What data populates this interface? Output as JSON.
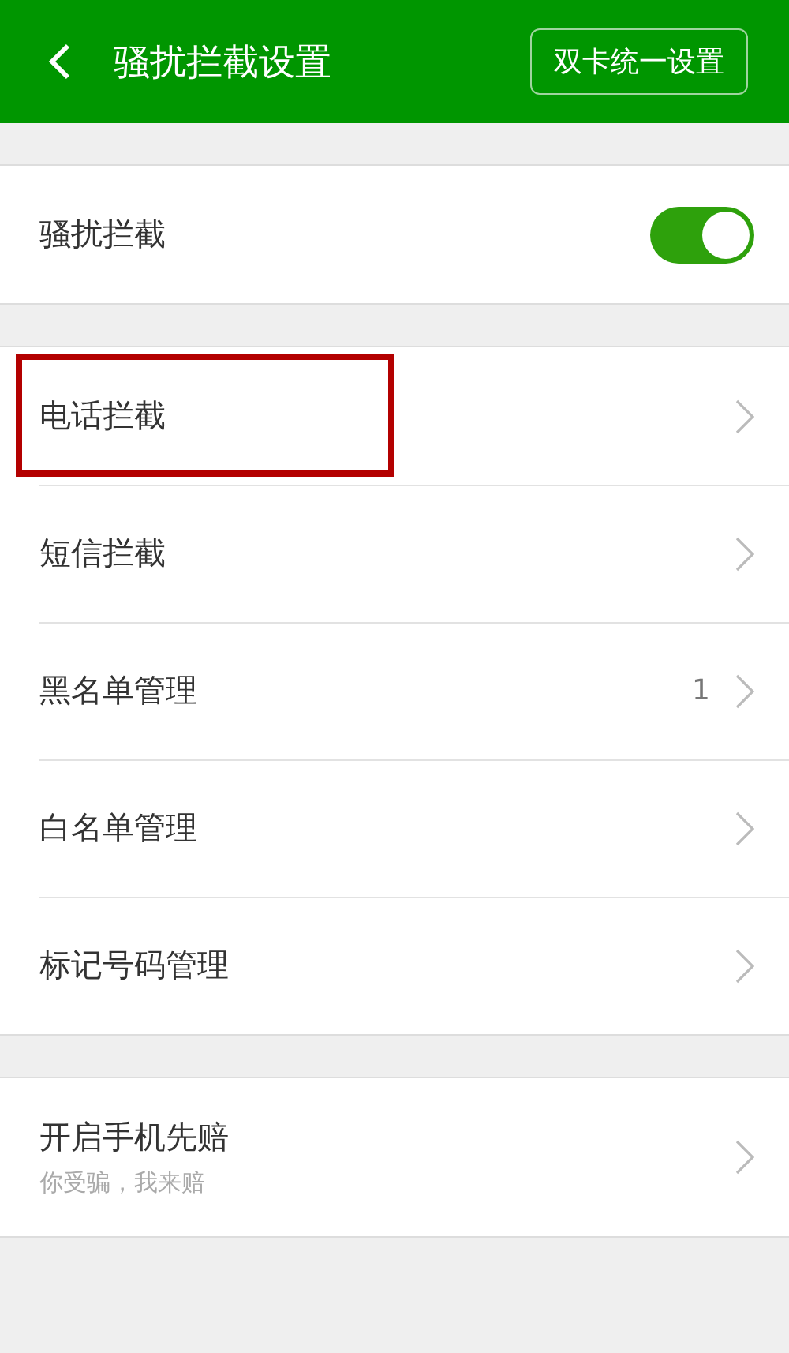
{
  "header": {
    "title": "骚扰拦截设置",
    "action": "双卡统一设置"
  },
  "master": {
    "label": "骚扰拦截",
    "on": true
  },
  "items": [
    {
      "label": "电话拦截",
      "highlighted": true
    },
    {
      "label": "短信拦截",
      "highlighted": false
    },
    {
      "label": "黑名单管理",
      "count": "1",
      "highlighted": false
    },
    {
      "label": "白名单管理",
      "highlighted": false
    },
    {
      "label": "标记号码管理",
      "highlighted": false
    }
  ],
  "compensation": {
    "label": "开启手机先赔",
    "subtitle": "你受骗，我来赔"
  }
}
